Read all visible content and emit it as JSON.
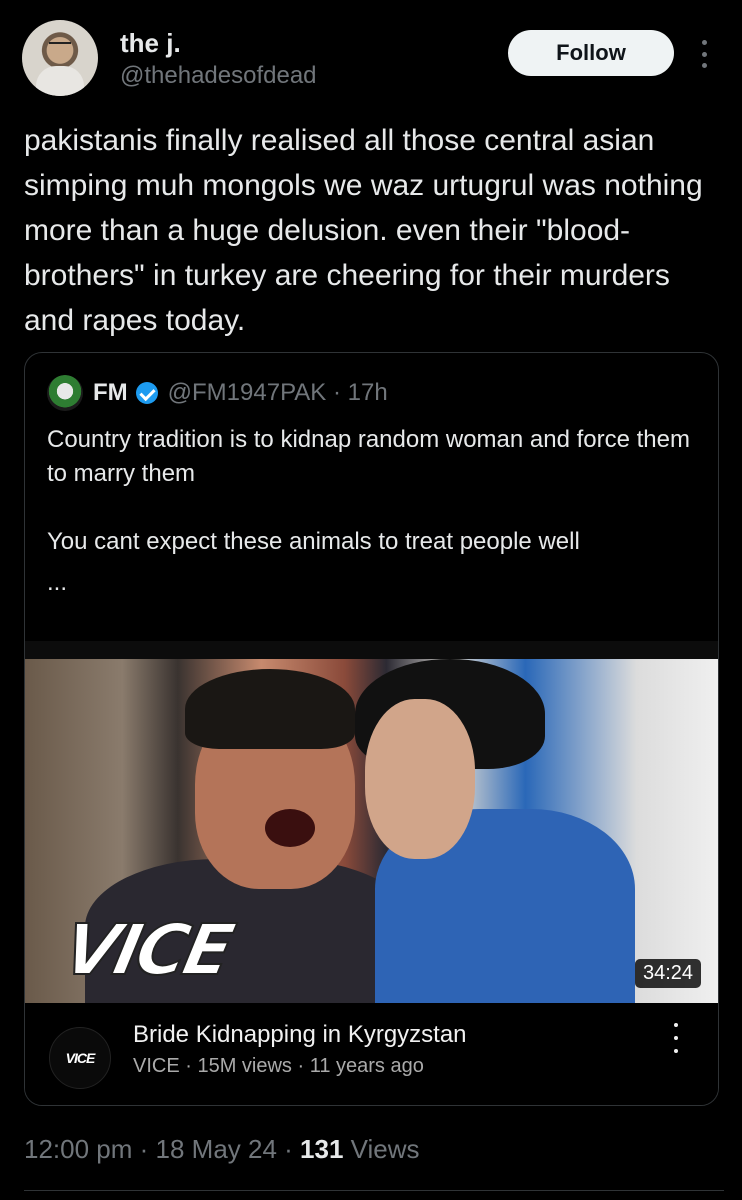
{
  "author": {
    "name": "the j.",
    "handle": "@thehadesofdead",
    "avatar_icon": "user-avatar"
  },
  "follow_label": "Follow",
  "tweet": {
    "text": "pakistanis finally realised all those central asian simping muh mongols we waz urtugrul was nothing more than a huge delusion. even their \"blood-brothers\" in turkey are cheering for their murders and rapes today."
  },
  "quote": {
    "name": "FM",
    "handle": "@FM1947PAK",
    "separator": "·",
    "time": "17h",
    "text": "Country tradition is to kidnap random woman and force them to marry them\n\nYou cant expect these animals to treat people well",
    "ellipsis": "...",
    "verified_color": "#1d9bf0",
    "video": {
      "logo_text": "VICE",
      "duration": "34:24",
      "title": "Bride Kidnapping in Kyrgyzstan",
      "meta": "VICE · 15M views · 11 years ago",
      "channel_icon_text": "VICE"
    }
  },
  "footer": {
    "time": "12:00 pm",
    "sep1": " · ",
    "date": "18 May 24",
    "sep2": " · ",
    "views_count": "131",
    "views_label": " Views"
  }
}
